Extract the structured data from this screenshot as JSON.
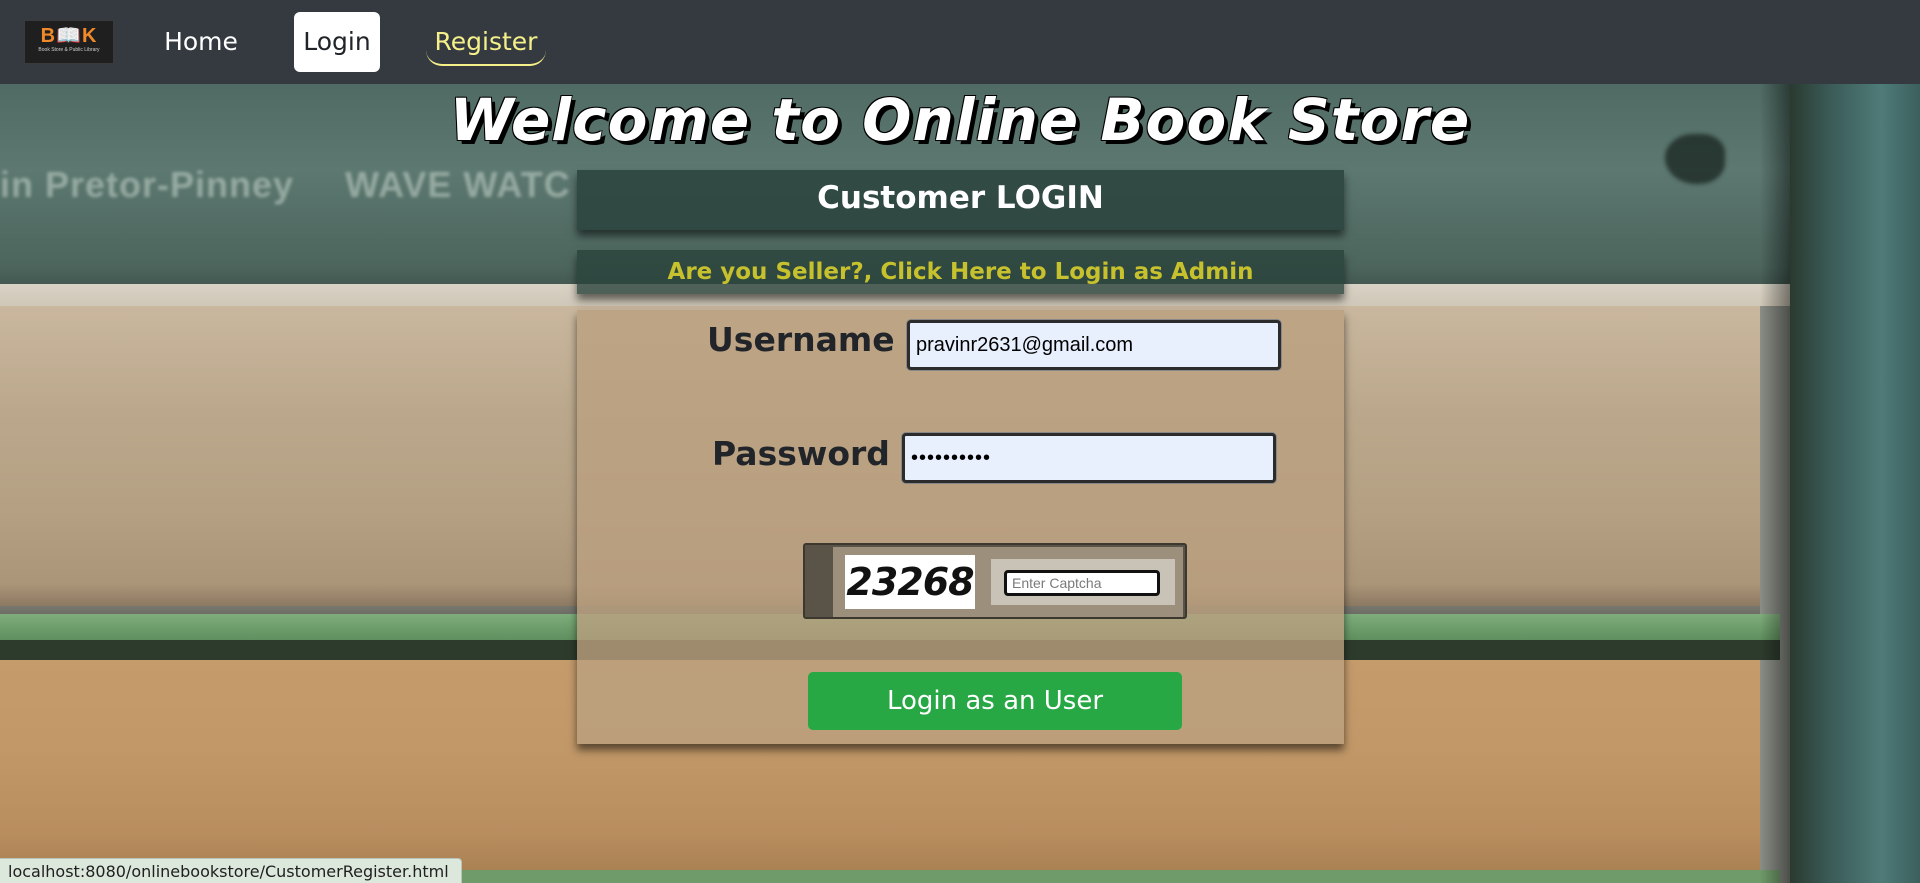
{
  "navbar": {
    "logo_text": "B📖K",
    "logo_subtext": "Book Store & Public Library",
    "links": {
      "home": "Home",
      "login": "Login",
      "register": "Register"
    }
  },
  "background": {
    "spine_texts": [
      "in Pretor-Pinney",
      "WAVE WATC"
    ]
  },
  "page": {
    "welcome_title": "Welcome to Online Book Store"
  },
  "login_panel": {
    "title": "Customer LOGIN",
    "admin_link": "Are you Seller?, Click Here to Login as Admin",
    "username_label": "Username :",
    "username_value": "pravinr2631@gmail.com",
    "password_label": "Password :",
    "password_value": "••••••••••",
    "captcha_code": "23268",
    "captcha_placeholder": "Enter Captcha",
    "submit_label": "Login as an User"
  },
  "statusbar": {
    "url": "localhost:8080/onlinebookstore/CustomerRegister.html"
  },
  "colors": {
    "navbar_bg": "#343a40",
    "register_accent": "#f5f08a",
    "admin_link": "#c7c12d",
    "submit_button": "#28a745"
  }
}
